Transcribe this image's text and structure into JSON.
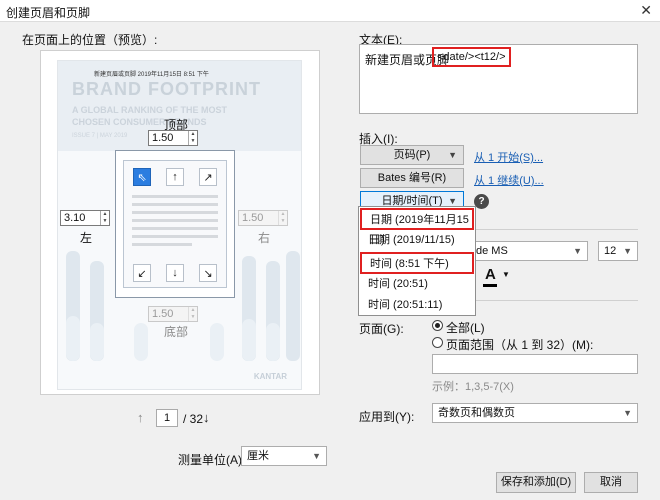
{
  "window": {
    "title": "创建页眉和页脚",
    "close_glyph": "✕"
  },
  "preview": {
    "label": "在页面上的位置（预览）:",
    "doc_header_small": "新建页眉或页脚 2019年11月15日 8:51 下午",
    "doc_brand": "BRAND FOOTPRINT",
    "doc_sub1": "A GLOBAL RANKING OF THE MOST",
    "doc_sub2": "CHOSEN CONSUMER BRANDS",
    "doc_issue": "ISSUE 7 | MAY 2019",
    "doc_footer_brand": "KANTAR",
    "top_label": "顶部",
    "top_value": "1.50",
    "left_label": "左",
    "left_value": "3.10",
    "right_label": "右",
    "right_value": "1.50",
    "bottom_label": "底部",
    "bottom_value": "1.50",
    "arrows": {
      "nw": "⇖",
      "n": "↑",
      "ne": "↗",
      "sw": "↙",
      "s": "↓",
      "se": "↘"
    }
  },
  "pager": {
    "up": "↑",
    "current": "1",
    "total": "/ 32",
    "down": "↓"
  },
  "units": {
    "label": "测量单位(A):",
    "value": "厘米"
  },
  "text": {
    "label": "文本(E):",
    "prefix": "新建页眉或页脚",
    "token": "<date/><t12/>"
  },
  "insert": {
    "label": "插入(I):",
    "page_button": "页码(P)",
    "page_link": "从 1 开始(S)...",
    "bates_button": "Bates 编号(R)",
    "bates_link": "从 1 继续(U)...",
    "datetime_button": "日期/时间(T)",
    "help": "?",
    "menu": [
      "日期 (2019年11月15日)",
      "日期 (2019/11/15)",
      "时间 (8:51 下午)",
      "时间 (20:51)",
      "时间 (20:51:11)"
    ]
  },
  "font": {
    "family_tail": "de MS",
    "size": "12",
    "color_glyph": "A"
  },
  "pages": {
    "label": "页面(G):",
    "all": "全部(L)",
    "range": "页面范围（从 1 到 32）(M):",
    "example": "示例：1,3,5-7(X)"
  },
  "apply": {
    "label": "应用到(Y):",
    "value": "奇数页和偶数页"
  },
  "buttons": {
    "save_add": "保存和添加(D)",
    "cancel": "取消"
  }
}
